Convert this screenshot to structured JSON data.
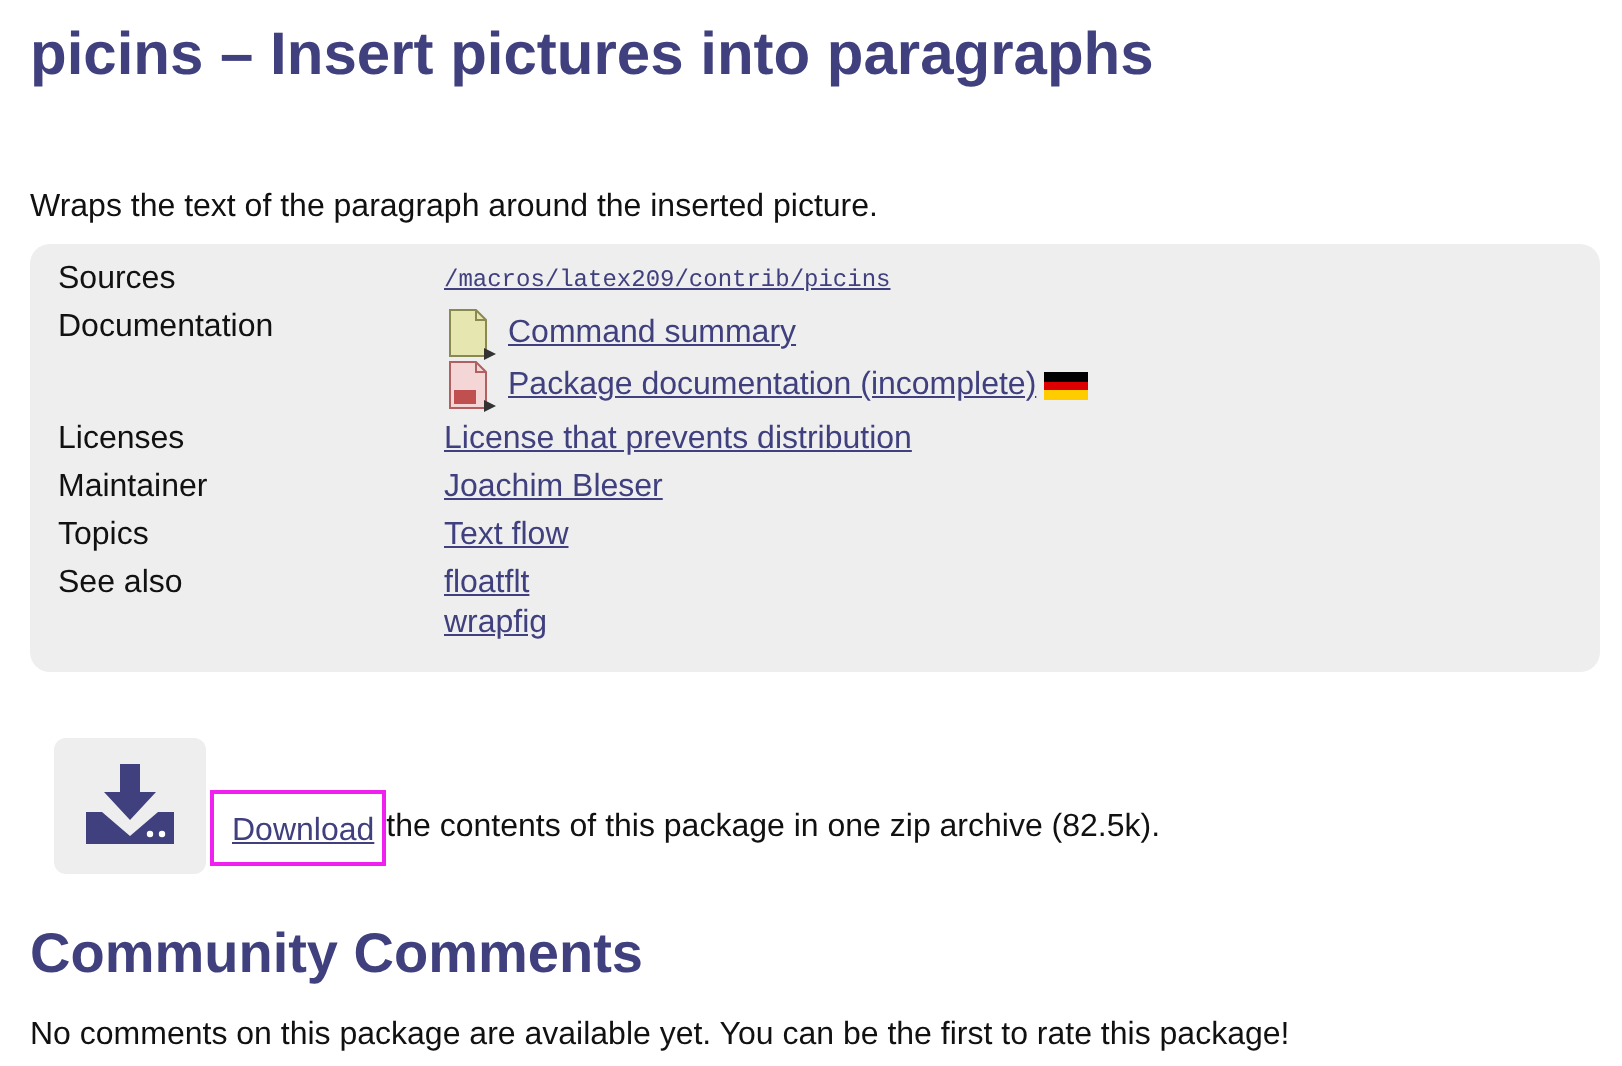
{
  "title": "picins – Insert pictures into paragraphs",
  "description": "Wraps the text of the paragraph around the inserted picture.",
  "details": [
    {
      "label": "Sources",
      "values": [
        {
          "kind": "code",
          "text": "/macros/latex209/contrib/picins"
        }
      ]
    },
    {
      "label": "Documentation",
      "values": [
        {
          "kind": "textdoc",
          "text": "Command summary"
        },
        {
          "kind": "dvidoc",
          "text": "Package documentation (incomplete)"
        }
      ]
    },
    {
      "label": "Licenses",
      "values": [
        {
          "kind": "link",
          "text": "License that prevents distribution"
        }
      ]
    },
    {
      "label": "Maintainer",
      "values": [
        {
          "kind": "link",
          "text": "Joachim Bleser"
        }
      ]
    },
    {
      "label": "Topics",
      "values": [
        {
          "kind": "link",
          "text": "Text flow"
        }
      ]
    },
    {
      "label": "See also",
      "values": [
        {
          "kind": "link",
          "text": "floatflt"
        },
        {
          "kind": "link",
          "text": "wrapfig"
        }
      ]
    }
  ],
  "download": {
    "link": "Download",
    "highlighted": true,
    "text": "the contents of this package in one zip archive (82.5k)."
  },
  "comments": {
    "heading": "Community Comments",
    "text": "No comments on this package are available yet. You can be the first to rate this package!"
  }
}
